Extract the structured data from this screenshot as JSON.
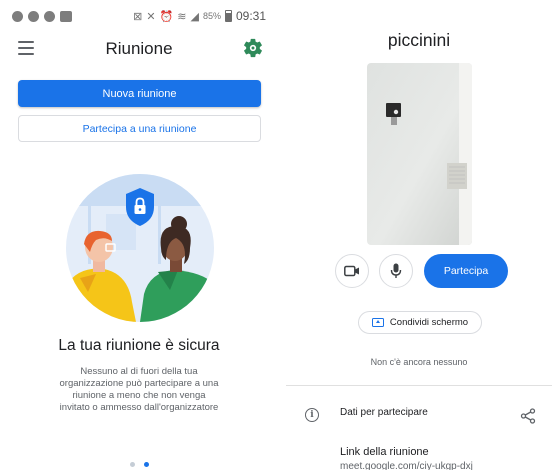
{
  "status_bar": {
    "battery": "85%",
    "time": "09:31"
  },
  "home": {
    "title": "Riunione",
    "new_meeting_label": "Nuova riunione",
    "join_meeting_label": "Partecipa a una riunione",
    "headline": "La tua riunione è sicura",
    "body": "Nessuno al di fuori della tua organizzazione può partecipare a una riunione a meno che non venga invitato o ammesso dall'organizzatore",
    "page_indicator": {
      "total": 2,
      "current": 2
    }
  },
  "join_screen": {
    "meeting_name": "piccinini",
    "join_label": "Partecipa",
    "share_screen_label": "Condividi schermo",
    "nobody_here": "Non c'è ancora nessuno",
    "join_info_label": "Dati per partecipare",
    "meeting_link_label": "Link della riunione",
    "meeting_link_url": "meet.google.com/ciy-ukgp-dxj"
  },
  "colors": {
    "accent": "#1a73e8",
    "gear": "#2f8a5a"
  },
  "icons": [
    "menu-icon",
    "gear-icon",
    "shield-lock-icon",
    "camera-icon",
    "mic-icon",
    "present-screen-icon",
    "info-icon",
    "share-icon"
  ]
}
